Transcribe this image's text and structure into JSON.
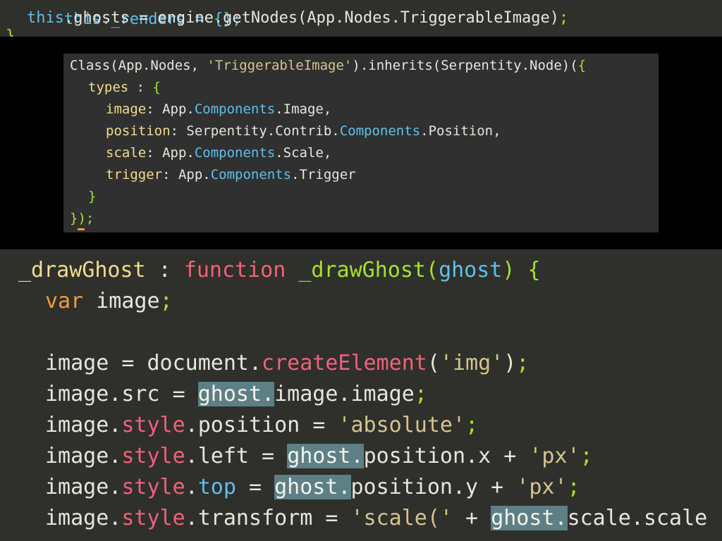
{
  "top": {
    "line1": "this._renders = {};",
    "line2": {
      "this": "this",
      "rest1": ".ghosts = engine.getNodes(App.Nodes.TriggerableImage)",
      "semi": ";"
    },
    "line3": "}"
  },
  "mid": {
    "l1a": "Class(App.Nodes, ",
    "l1str": "'TriggerableImage'",
    "l1b": ").inherits(Serpentity.Node)(",
    "l1c": "{",
    "l2key": "types",
    "l2rest": " : ",
    "l2brace": "{",
    "l3key": "image",
    "l3a": ": App.",
    "l3c": "Components",
    "l3b": ".Image,",
    "l4key": "position",
    "l4a": ": Serpentity.Contrib.",
    "l4c": "Components",
    "l4b": ".Position,",
    "l5key": "scale",
    "l5a": ": App.",
    "l5c": "Components",
    "l5b": ".Scale,",
    "l6key": "trigger",
    "l6a": ": App.",
    "l6c": "Components",
    "l6b": ".Trigger",
    "l7": "}",
    "l8a": "})",
    "l8b": ";"
  },
  "bot": {
    "l1name": "_drawGhost",
    "l1sep": " : ",
    "l1kw": "function",
    "l1fn": " _drawGhost",
    "l1p1": "(",
    "l1arg": "ghost",
    "l1p2": ") ",
    "l1brace": "{",
    "l2kw": "var",
    "l2rest": " image",
    "l2semi": ";",
    "l4a": "image = document.",
    "l4fn": "createElement",
    "l4b": "(",
    "l4str": "'img'",
    "l4c": ")",
    "l4semi": ";",
    "l5a": "image.src = ",
    "l5hl": "ghost.",
    "l5b": "image.image",
    "l5semi": ";",
    "l6a": "image.",
    "l6style": "style",
    "l6b": ".position = ",
    "l6str": "'absolute'",
    "l6semi": ";",
    "l7a": "image.",
    "l7style": "style",
    "l7b": ".left = ",
    "l7hl": "ghost.",
    "l7c": "position.x + ",
    "l7str": "'px'",
    "l7semi": ";",
    "l8a": "image.",
    "l8style": "style",
    "l8dot": ".",
    "l8top": "top",
    "l8b": " = ",
    "l8hl": "ghost.",
    "l8c": "position.y + ",
    "l8str": "'px'",
    "l8semi": ";",
    "l9a": "image.",
    "l9style": "style",
    "l9b": ".transform = ",
    "l9str": "'scale('",
    "l9c": " + ",
    "l9hl": "ghost.",
    "l9d": "scale.scale"
  }
}
